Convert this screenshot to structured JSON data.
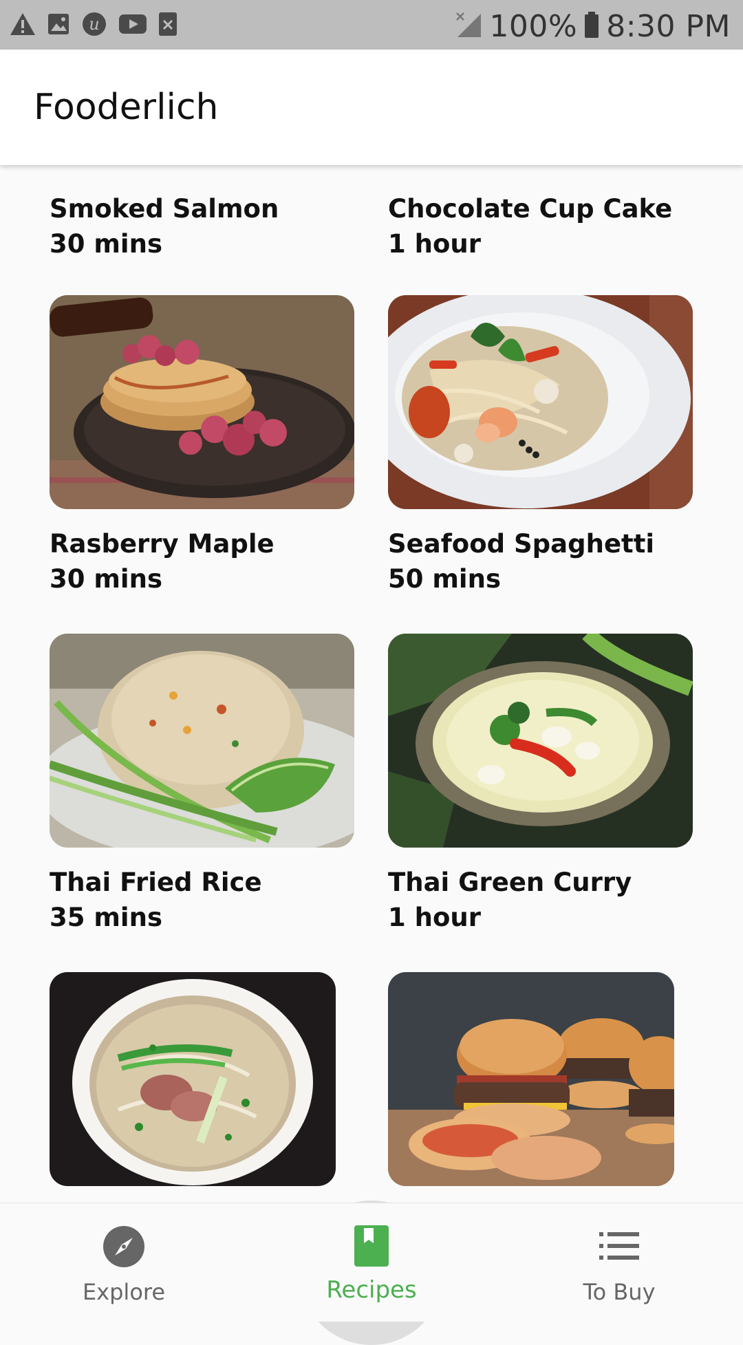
{
  "status_bar": {
    "battery": "100%",
    "time": "8:30 PM",
    "left_icons": [
      "warning-icon",
      "image-icon",
      "upwork-icon",
      "youtube-icon",
      "close-box-icon"
    ],
    "right_icons": [
      "no-signal-icon",
      "battery-icon"
    ]
  },
  "app_bar": {
    "title": "Fooderlich"
  },
  "recipes": [
    {
      "name": "Smoked Salmon",
      "time": "30 mins"
    },
    {
      "name": "Chocolate Cup Cake",
      "time": "1 hour"
    },
    {
      "name": "Rasberry Maple",
      "time": "30 mins"
    },
    {
      "name": "Seafood Spaghetti",
      "time": "50 mins"
    },
    {
      "name": "Thai Fried Rice",
      "time": "35 mins"
    },
    {
      "name": "Thai Green Curry",
      "time": "1 hour"
    },
    {
      "name": "",
      "time": ""
    },
    {
      "name": "",
      "time": ""
    }
  ],
  "bottom_nav": {
    "items": [
      {
        "label": "Explore",
        "icon": "compass-icon"
      },
      {
        "label": "Recipes",
        "icon": "book-icon",
        "active": true
      },
      {
        "label": "To Buy",
        "icon": "list-icon"
      }
    ]
  },
  "colors": {
    "status_bar_bg": "#bdbdbd",
    "accent": "#4caf50",
    "background": "#fafafa",
    "text": "#111111"
  }
}
